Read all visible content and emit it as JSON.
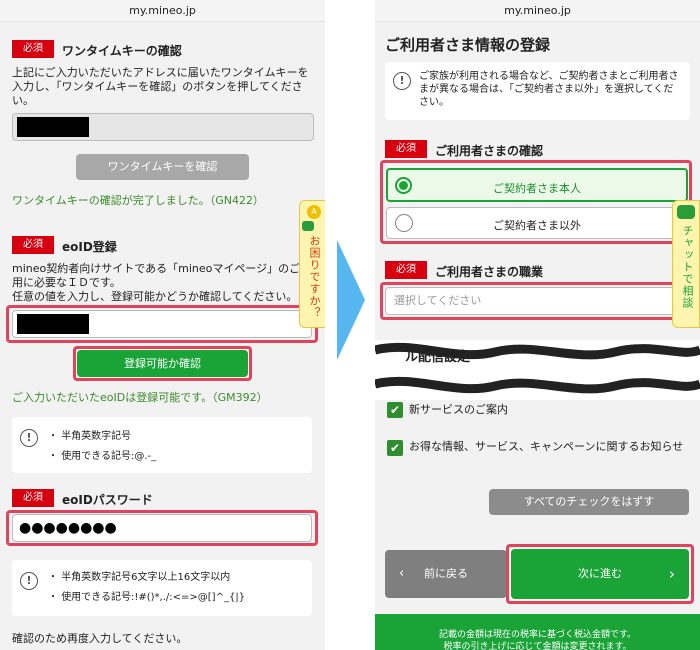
{
  "left": {
    "url": "my.mineo.jp",
    "required_label": "必須",
    "onetime": {
      "title": "ワンタイムキーの確認",
      "description": "上記にご入力いただいたアドレスに届いたワンタイムキーを入力し、「ワンタイムキーを確認」のボタンを押してください。",
      "button": "ワンタイムキーを確認",
      "success": "ワンタイムキーの確認が完了しました。（GN422）"
    },
    "eoid": {
      "title": "eoID登録",
      "description": "mineo契約者向けサイトである「mineoマイページ」のご利用に必要なＩＤです。\n任意の値を入力し、登録可能かどうか確認してください。",
      "button": "登録可能か確認",
      "success": "ご入力いただいたeoIDは登録可能です。（GM392）",
      "notes": [
        "半角英数字記号",
        "使用できる記号:@.-_"
      ]
    },
    "password": {
      "title": "eoIDパスワード",
      "value": "●●●●●●●●",
      "notes": [
        "半角英数字記号6文字以上16文字以内",
        "使用できる記号:!#()*,./:<=>@[]^_{|}"
      ]
    },
    "confirm_label": "確認のため再度入力してください。",
    "help_tab": "お困りですか？"
  },
  "right": {
    "url": "my.mineo.jp",
    "page_title": "ご利用者さま情報の登録",
    "info_note": "ご家族が利用される場合など、ご契約者さまとご利用者さまが異なる場合は、「ご契約者さま以外」を選択してください。",
    "required_label": "必須",
    "user_confirm_title": "ご利用者さまの確認",
    "radio_options": [
      "ご契約者さま本人",
      "ご契約者さま以外"
    ],
    "occupation_title": "ご利用者さまの職業",
    "select_placeholder": "選択してください",
    "mail_heading": "ル配信設定",
    "checkbox_items": [
      "新サービスのご案内",
      "お得な情報、サービス、キャンペーンに関するお知らせ"
    ],
    "uncheck_all": "すべてのチェックをはずす",
    "back_button": "前に戻る",
    "next_button": "次に進む",
    "footer_lines": [
      "記載の金額は現在の税率に基づく税込金額です。",
      "税率の引き上げに応じて金額は変更されます。"
    ],
    "chat_tab": "チャットで相談"
  },
  "colors": {
    "green": "#1aa337",
    "red": "#d7000f",
    "highlight": "#e0445c",
    "arrow": "#55b6f0"
  }
}
